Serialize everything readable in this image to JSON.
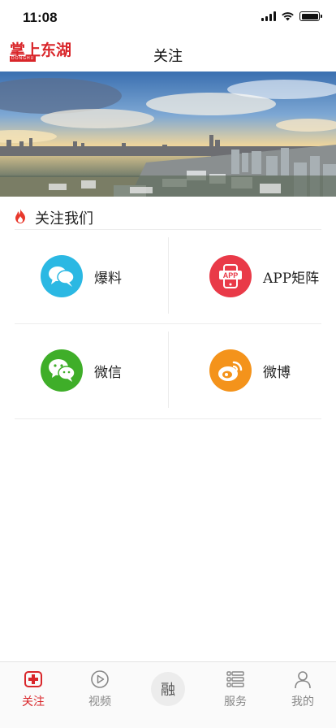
{
  "status_bar": {
    "time": "11:08",
    "battery_level": 1.0
  },
  "header": {
    "logo_text": "掌上东湖",
    "logo_subtext": "DONGHU",
    "title": "关注"
  },
  "section": {
    "title": "关注我们",
    "icon": "flame-icon",
    "accent_color": "#e8382c"
  },
  "grid": [
    {
      "label": "爆料",
      "icon": "chat-bubbles-icon",
      "color": "#2bb8e3"
    },
    {
      "label": "APP矩阵",
      "icon": "app-phone-icon",
      "color": "#e93a48"
    },
    {
      "label": "微信",
      "icon": "wechat-icon",
      "color": "#3fae29"
    },
    {
      "label": "微博",
      "icon": "weibo-icon",
      "color": "#f4931b"
    }
  ],
  "tabbar": {
    "tabs": [
      {
        "label": "关注",
        "icon": "plus-box-icon",
        "active": true
      },
      {
        "label": "视频",
        "icon": "play-circle-icon",
        "active": false
      },
      {
        "label": "融",
        "icon": "center-rong-icon",
        "active": false
      },
      {
        "label": "服务",
        "icon": "list-icon",
        "active": false
      },
      {
        "label": "我的",
        "icon": "user-icon",
        "active": false
      }
    ],
    "active_color": "#d9262a",
    "inactive_color": "#888888"
  }
}
